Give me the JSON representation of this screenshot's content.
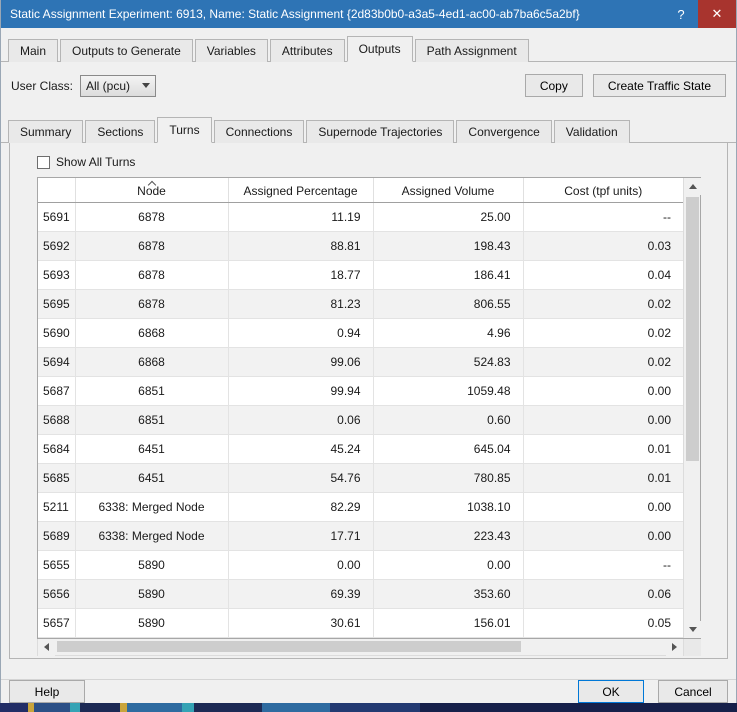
{
  "colors": {
    "titlebar": "#2e74b5",
    "close_button": "#a8342e",
    "default_button_border": "#0078d7"
  },
  "window": {
    "title": "Static Assignment Experiment: 6913, Name: Static Assignment {2d83b0b0-a3a5-4ed1-ac00-ab7ba6c5a2bf}",
    "help_glyph": "?",
    "close_glyph": "✕"
  },
  "tabs": [
    "Main",
    "Outputs to Generate",
    "Variables",
    "Attributes",
    "Outputs",
    "Path Assignment"
  ],
  "active_tab": "Outputs",
  "toolbar": {
    "user_class_label": "User Class:",
    "user_class_value": "All (pcu)",
    "copy_label": "Copy",
    "create_traffic_state_label": "Create Traffic State"
  },
  "subtabs": [
    "Summary",
    "Sections",
    "Turns",
    "Connections",
    "Supernode Trajectories",
    "Convergence",
    "Validation"
  ],
  "active_subtab": "Turns",
  "panel": {
    "show_all_turns_label": "Show All Turns",
    "show_all_turns_checked": false
  },
  "table": {
    "columns": [
      "",
      "Node",
      "Assigned Percentage",
      "Assigned Volume",
      "Cost (tpf units)"
    ],
    "sort": {
      "column": "Node",
      "direction": "ascending"
    },
    "rows": [
      {
        "id": "5691",
        "node": "6878",
        "pct": "11.19",
        "vol": "25.00",
        "cost": "--"
      },
      {
        "id": "5692",
        "node": "6878",
        "pct": "88.81",
        "vol": "198.43",
        "cost": "0.03"
      },
      {
        "id": "5693",
        "node": "6878",
        "pct": "18.77",
        "vol": "186.41",
        "cost": "0.04"
      },
      {
        "id": "5695",
        "node": "6878",
        "pct": "81.23",
        "vol": "806.55",
        "cost": "0.02"
      },
      {
        "id": "5690",
        "node": "6868",
        "pct": "0.94",
        "vol": "4.96",
        "cost": "0.02"
      },
      {
        "id": "5694",
        "node": "6868",
        "pct": "99.06",
        "vol": "524.83",
        "cost": "0.02"
      },
      {
        "id": "5687",
        "node": "6851",
        "pct": "99.94",
        "vol": "1059.48",
        "cost": "0.00"
      },
      {
        "id": "5688",
        "node": "6851",
        "pct": "0.06",
        "vol": "0.60",
        "cost": "0.00"
      },
      {
        "id": "5684",
        "node": "6451",
        "pct": "45.24",
        "vol": "645.04",
        "cost": "0.01"
      },
      {
        "id": "5685",
        "node": "6451",
        "pct": "54.76",
        "vol": "780.85",
        "cost": "0.01"
      },
      {
        "id": "5211",
        "node": "6338: Merged Node",
        "pct": "82.29",
        "vol": "1038.10",
        "cost": "0.00"
      },
      {
        "id": "5689",
        "node": "6338: Merged Node",
        "pct": "17.71",
        "vol": "223.43",
        "cost": "0.00"
      },
      {
        "id": "5655",
        "node": "5890",
        "pct": "0.00",
        "vol": "0.00",
        "cost": "--"
      },
      {
        "id": "5656",
        "node": "5890",
        "pct": "69.39",
        "vol": "353.60",
        "cost": "0.06"
      },
      {
        "id": "5657",
        "node": "5890",
        "pct": "30.61",
        "vol": "156.01",
        "cost": "0.05"
      }
    ]
  },
  "footer": {
    "help_label": "Help",
    "ok_label": "OK",
    "cancel_label": "Cancel"
  }
}
